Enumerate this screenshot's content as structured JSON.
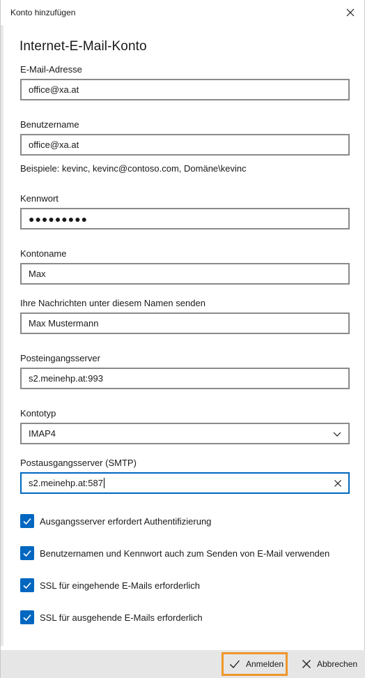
{
  "window": {
    "title": "Konto hinzufügen",
    "close_icon": "close-icon"
  },
  "heading": "Internet-E-Mail-Konto",
  "fields": {
    "email": {
      "label": "E-Mail-Adresse",
      "value": "office@xa.at"
    },
    "username": {
      "label": "Benutzername",
      "value": "office@xa.at",
      "hint": "Beispiele: kevinc, kevinc@contoso.com, Domäne\\kevinc"
    },
    "password": {
      "label": "Kennwort",
      "value": "●●●●●●●●●"
    },
    "account_name": {
      "label": "Kontoname",
      "value": "Max"
    },
    "send_name": {
      "label": "Ihre Nachrichten unter diesem Namen senden",
      "value": "Max Mustermann"
    },
    "incoming": {
      "label": "Posteingangsserver",
      "value": "s2.meinehp.at:993"
    },
    "account_type": {
      "label": "Kontotyp",
      "value": "IMAP4"
    },
    "outgoing": {
      "label": "Postausgangsserver (SMTP)",
      "value": "s2.meinehp.at:587"
    }
  },
  "checkboxes": [
    {
      "label": "Ausgangsserver erfordert Authentifizierung",
      "checked": true
    },
    {
      "label": "Benutzernamen und Kennwort auch zum Senden von E-Mail verwenden",
      "checked": true
    },
    {
      "label": "SSL für eingehende E-Mails erforderlich",
      "checked": true
    },
    {
      "label": "SSL für ausgehende E-Mails erforderlich",
      "checked": true
    }
  ],
  "footer": {
    "primary_label": "Anmelden",
    "cancel_label": "Abbrechen"
  },
  "colors": {
    "accent": "#0067c0",
    "focus_outline": "#f0962a",
    "footer_bg": "#e6e6e6"
  }
}
